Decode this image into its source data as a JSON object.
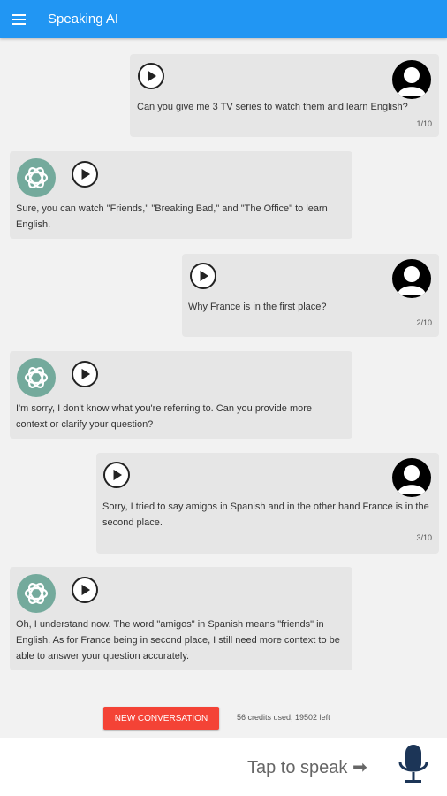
{
  "app": {
    "title": "Speaking AI"
  },
  "messages": [
    {
      "role": "user",
      "text": "Can you give me 3 TV series to watch them and learn English?",
      "counter": "1/10"
    },
    {
      "role": "assistant",
      "text": "Sure, you can watch \"Friends,\" \"Breaking Bad,\" and \"The Office\" to learn English."
    },
    {
      "role": "user",
      "text": "Why France is in the first place?",
      "counter": "2/10"
    },
    {
      "role": "assistant",
      "text": "I'm sorry, I don't know what you're referring to. Can you provide more context or clarify your question?"
    },
    {
      "role": "user",
      "text": "Sorry, I tried to say amigos in Spanish and in the other hand France is in the second place.",
      "counter": "3/10"
    },
    {
      "role": "assistant",
      "text": "Oh, I understand now. The word \"amigos\" in Spanish means \"friends\" in English. As for France being in second place, I still need more context to be able to answer your question accurately."
    }
  ],
  "footer": {
    "new_conversation_label": "NEW CONVERSATION",
    "credits": "56 credits used, 19502 left",
    "tap_to_speak": "Tap to speak ➡"
  },
  "colors": {
    "appbar": "#2196f3",
    "button": "#f44336",
    "gpt_avatar": "#74aa9c",
    "mic": "#1c3557"
  },
  "icons": [
    "menu-icon",
    "play-icon",
    "user-avatar-icon",
    "chatgpt-logo-icon",
    "microphone-icon"
  ]
}
